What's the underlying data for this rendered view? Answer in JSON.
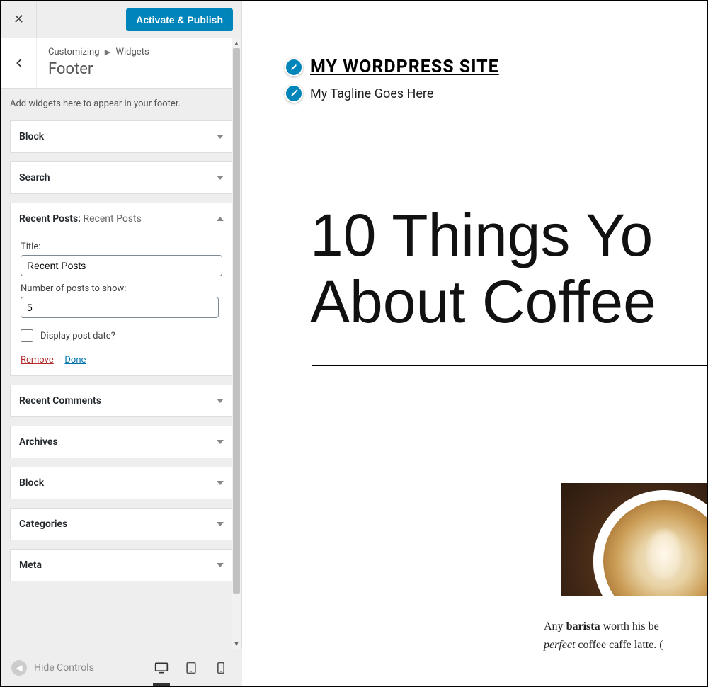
{
  "header": {
    "publish_label": "Activate & Publish"
  },
  "breadcrumb": {
    "customizing": "Customizing",
    "section": "Widgets",
    "title": "Footer"
  },
  "panel": {
    "description": "Add widgets here to appear in your footer.",
    "widgets": [
      {
        "label": "Block",
        "expanded": false
      },
      {
        "label": "Search",
        "expanded": false
      },
      {
        "label": "Recent Posts:",
        "sublabel": "Recent Posts",
        "expanded": true
      },
      {
        "label": "Recent Comments",
        "expanded": false
      },
      {
        "label": "Archives",
        "expanded": false
      },
      {
        "label": "Block",
        "expanded": false
      },
      {
        "label": "Categories",
        "expanded": false
      },
      {
        "label": "Meta",
        "expanded": false
      }
    ],
    "recent_posts_form": {
      "title_label": "Title:",
      "title_value": "Recent Posts",
      "count_label": "Number of posts to show:",
      "count_value": "5",
      "display_date_label": "Display post date?",
      "display_date_checked": false,
      "remove_label": "Remove",
      "done_label": "Done"
    }
  },
  "footer_bar": {
    "hide_controls": "Hide Controls"
  },
  "preview": {
    "site_title": "MY WORDPRESS SITE",
    "tagline": "My Tagline Goes Here",
    "post_title_line1": "10 Things Yo",
    "post_title_line2": "About Coffee",
    "body_prefix": "Any ",
    "body_bold": "barista",
    "body_after_bold": " worth his be",
    "body_italic": "perfect",
    "body_strike": "coffee",
    "body_tail": " caffe latte. ("
  }
}
